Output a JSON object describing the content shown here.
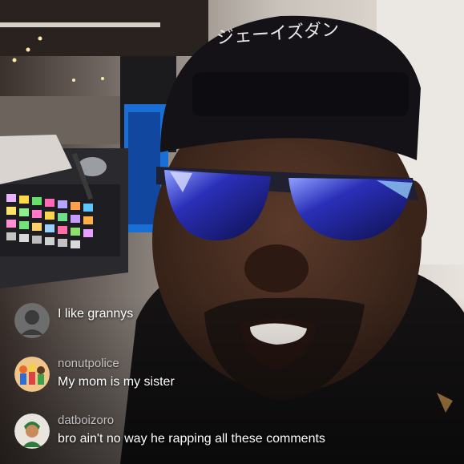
{
  "stream": {
    "hat_text": "ジェーイズダン"
  },
  "comments": [
    {
      "username": "",
      "message": "I like grannys",
      "avatar_icon": "silhouette-avatar-icon"
    },
    {
      "username": "nonutpolice",
      "message": "My mom is my sister",
      "avatar_icon": "cartoon-family-avatar-icon"
    },
    {
      "username": "datboizoro",
      "message": "bro ain't no way he rapping all these comments",
      "avatar_icon": "anime-character-avatar-icon"
    }
  ],
  "colors": {
    "lens_blue": "#3b3fd6",
    "comment_text": "#ffffff",
    "username_text": "#d9d9d9"
  }
}
